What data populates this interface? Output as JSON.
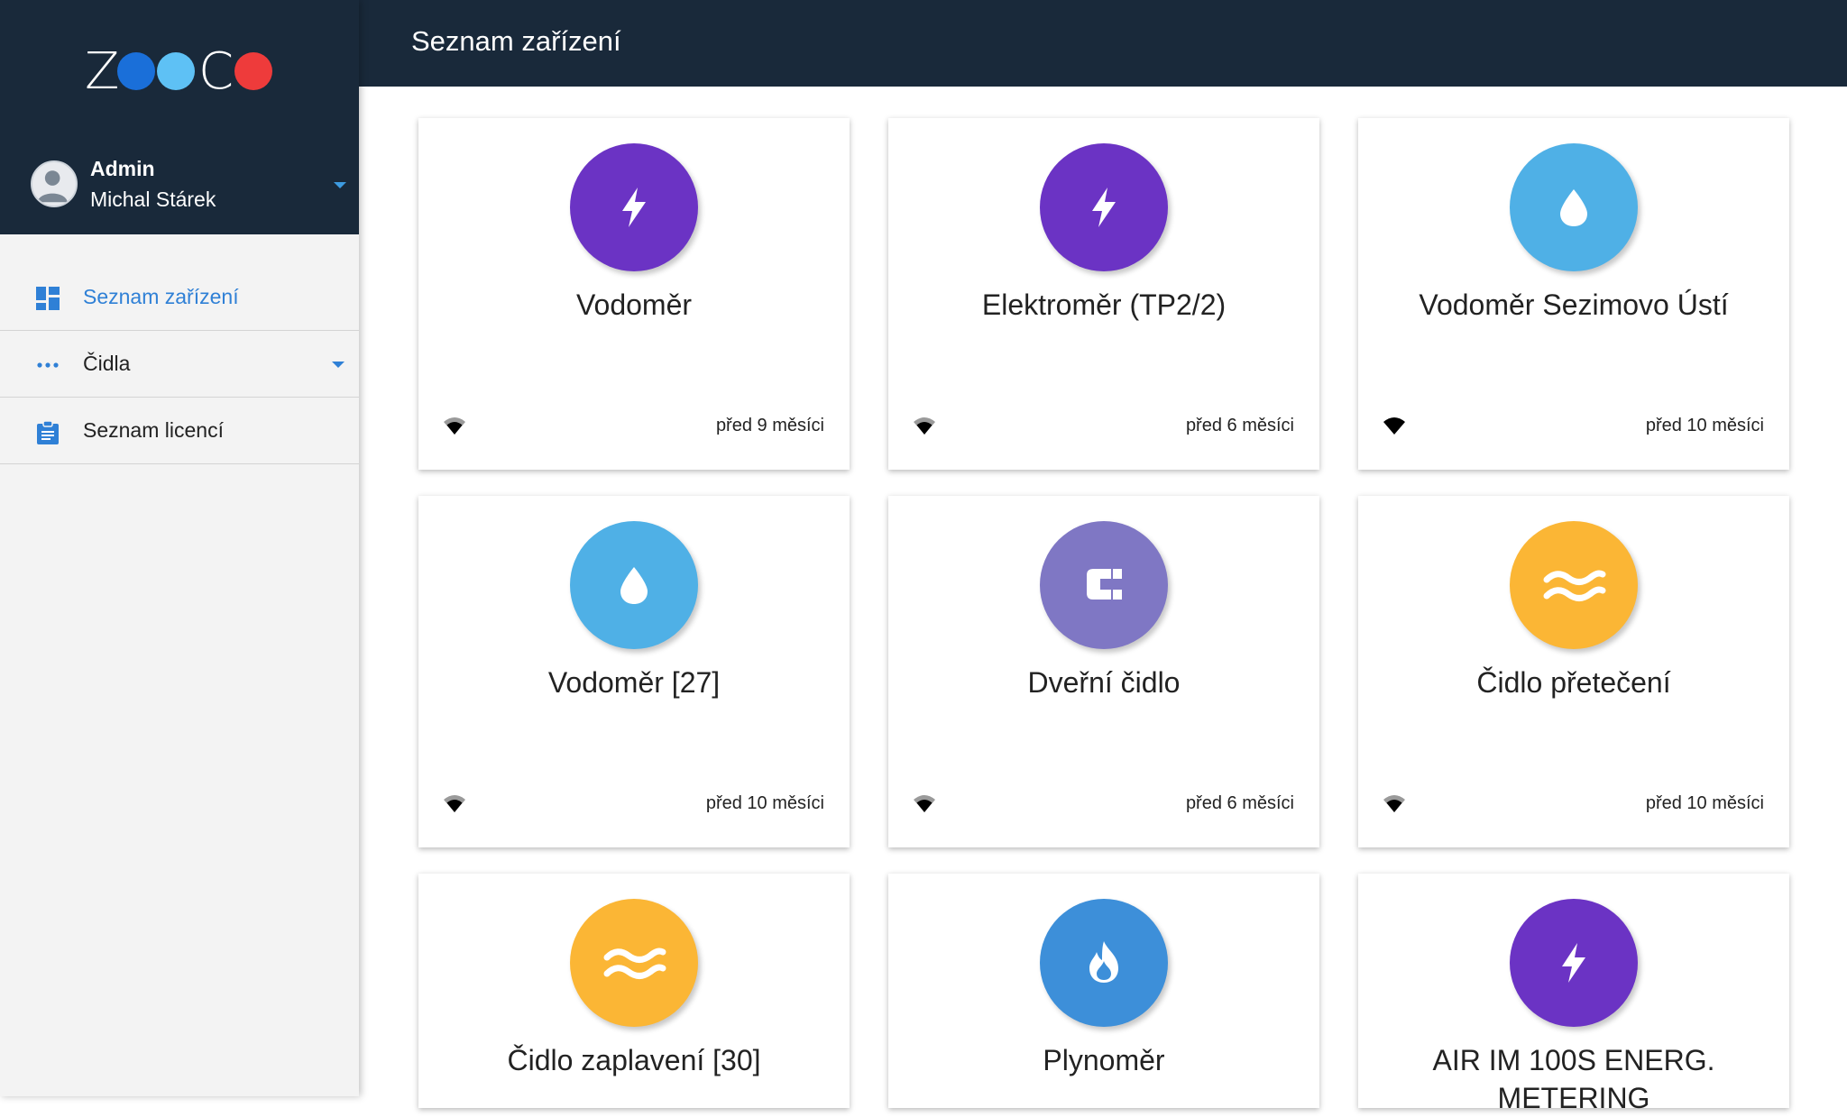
{
  "brand": {
    "logo_text": "ZOOCO",
    "colors": {
      "dark": "#19293a",
      "blue": "#1a6fd9",
      "light_blue": "#5ec1f5",
      "red": "#ee3b3b"
    }
  },
  "user": {
    "role": "Admin",
    "name": "Michal Stárek"
  },
  "nav": [
    {
      "label": "Seznam zařízení",
      "icon": "dashboard-icon",
      "active": true
    },
    {
      "label": "Čidla",
      "icon": "more-horizontal-icon",
      "active": false,
      "has_dropdown": true
    },
    {
      "label": "Seznam licencí",
      "icon": "clipboard-icon",
      "active": false
    }
  ],
  "header": {
    "title": "Seznam zařízení"
  },
  "devices": [
    {
      "name": "Vodoměr",
      "icon": "bolt-icon",
      "color": "#6b33c4",
      "time": "před 9 měsíci",
      "signal": "medium"
    },
    {
      "name": "Elektroměr (TP2/2)",
      "icon": "bolt-icon",
      "color": "#6b33c4",
      "time": "před 6 měsíci",
      "signal": "medium"
    },
    {
      "name": "Vodoměr Sezimovo Ústí",
      "icon": "water-drop-icon",
      "color": "#4fb0e6",
      "time": "před 10 měsíci",
      "signal": "full"
    },
    {
      "name": "Vodoměr [27]",
      "icon": "water-drop-icon",
      "color": "#4fb0e6",
      "time": "před 10 měsíci",
      "signal": "medium"
    },
    {
      "name": "Dveřní čidlo",
      "icon": "magnet-icon",
      "color": "#7f77c4",
      "time": "před 6 měsíci",
      "signal": "medium"
    },
    {
      "name": "Čidlo přetečení",
      "icon": "waves-icon",
      "color": "#fbb635",
      "time": "před 10 měsíci",
      "signal": "medium"
    },
    {
      "name": "Čidlo zaplavení [30]",
      "icon": "waves-icon",
      "color": "#fbb635",
      "time": "",
      "signal": ""
    },
    {
      "name": "Plynoměr",
      "icon": "flame-icon",
      "color": "#3d8fd9",
      "time": "",
      "signal": ""
    },
    {
      "name": "AIR IM 100S ENERG. METERING",
      "icon": "bolt-icon",
      "color": "#6b33c4",
      "time": "",
      "signal": ""
    }
  ]
}
